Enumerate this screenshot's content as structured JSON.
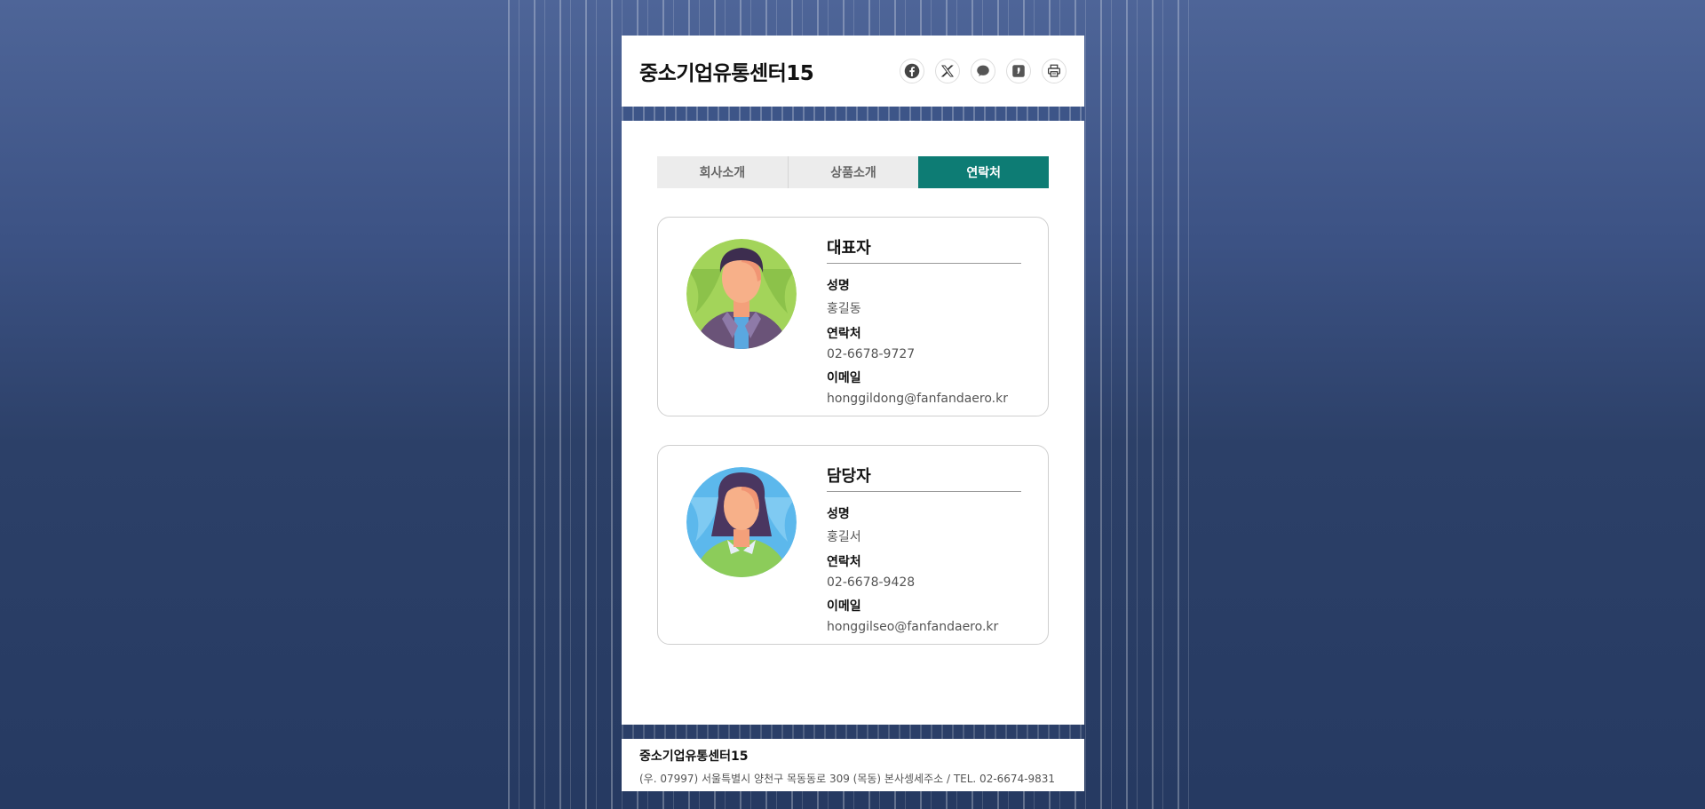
{
  "header": {
    "title": "중소기업유통센터15"
  },
  "share_icons": [
    "facebook-icon",
    "x-icon",
    "chat-icon",
    "kakao-story-icon",
    "print-icon"
  ],
  "tabs": [
    {
      "label": "회사소개",
      "active": false
    },
    {
      "label": "상품소개",
      "active": false
    },
    {
      "label": "연락처",
      "active": true
    }
  ],
  "contacts": [
    {
      "role": "대표자",
      "name_label": "성명",
      "name": "홍길동",
      "phone_label": "연락처",
      "phone": "02-6678-9727",
      "email_label": "이메일",
      "email": "honggildong@fanfandaero.kr"
    },
    {
      "role": "담당자",
      "name_label": "성명",
      "name": "홍길서",
      "phone_label": "연락처",
      "phone": "02-6678-9428",
      "email_label": "이메일",
      "email": "honggilseo@fanfandaero.kr"
    }
  ],
  "footer": {
    "title": "중소기업유통센터15",
    "address": "(우. 07997) 서울특별시 양천구 목동동로 309 (목동) 본사셍세주소 / TEL. 02-6674-9831"
  },
  "colors": {
    "accent": "#0d7c74",
    "background": "#3c5284"
  }
}
